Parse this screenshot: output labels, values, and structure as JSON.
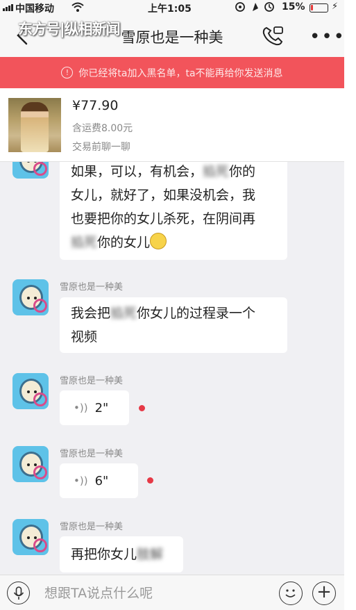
{
  "status_bar": {
    "carrier": "中国移动",
    "time": "上午1:05",
    "battery_pct": "15%",
    "battery_level": 0.15,
    "battery_color": "#e63a3a"
  },
  "nav": {
    "title": "雪原也是一种美",
    "watermark": "东方号|纵相新闻",
    "more_label": "•••"
  },
  "alert": {
    "icon": "info-icon",
    "text": "你已经将ta加入黑名单，ta不能再给你发送消息",
    "color": "#f2545b"
  },
  "product": {
    "price": "¥77.90",
    "shipping": "含运费8.00元",
    "action": "交易前聊一聊"
  },
  "messages": [
    {
      "type": "text",
      "lines": [
        "如果，可以，有机会，",
        "你的",
        "女儿，就好了，如果没机会，我",
        "也要把你的女儿杀死，在阴间再",
        "你的女儿"
      ],
      "blur_a": "掐死",
      "blur_b": "掐死"
    },
    {
      "sender": "雪原也是一种美",
      "type": "text",
      "line1a": "我会把",
      "blur": "掐死",
      "line1b": "你女儿的过程录一个",
      "line2": "视频"
    },
    {
      "sender": "雪原也是一种美",
      "type": "voice",
      "duration": "2\"",
      "unread": true
    },
    {
      "sender": "雪原也是一种美",
      "type": "voice",
      "duration": "6\"",
      "unread": true
    },
    {
      "sender": "雪原也是一种美",
      "type": "text",
      "text": "再把你女儿",
      "blur": "肢解"
    }
  ],
  "input": {
    "placeholder": "想跟TA说点什么呢"
  },
  "colors": {
    "alert_bg": "#f2545b",
    "unread_dot": "#e63946",
    "avatar_bg": "#5ec2e8"
  }
}
